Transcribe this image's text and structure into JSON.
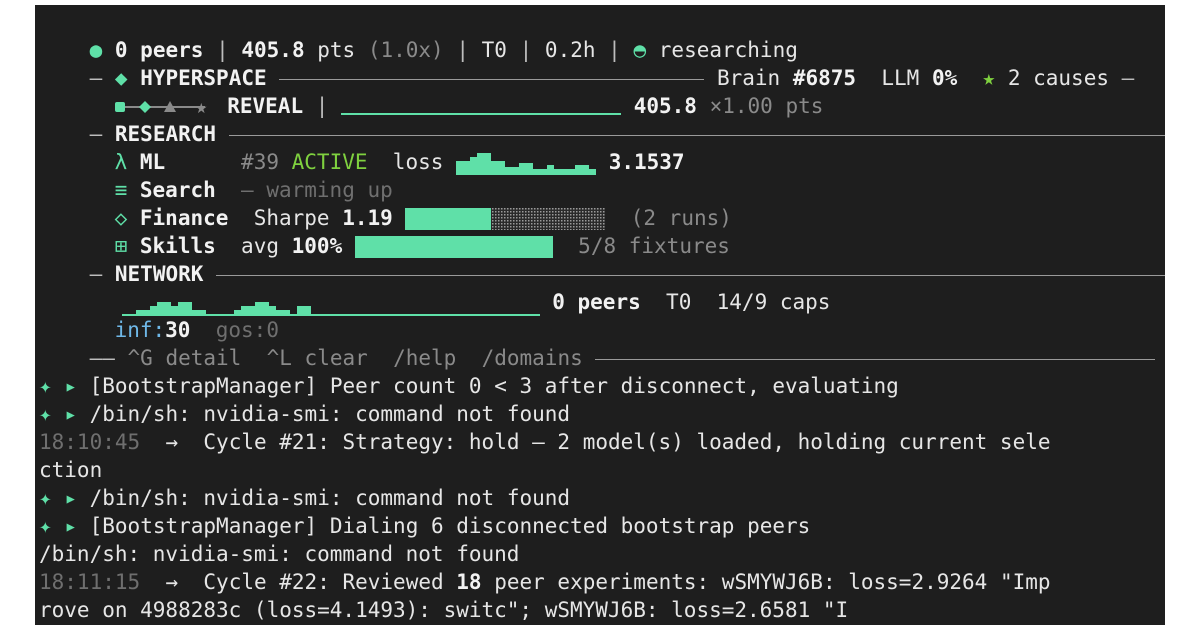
{
  "status": {
    "peers": "0 peers",
    "pts": "405.8",
    "pts_unit": " pts",
    "multiplier": "(1.0x)",
    "tier": "T0",
    "hours": "0.2h",
    "state": "researching"
  },
  "header": {
    "title": "HYPERSPACE",
    "brain_label": "Brain",
    "brain_id": "#6875",
    "llm_label": "LLM",
    "llm_value": "0%",
    "causes": "2 causes"
  },
  "reveal": {
    "label": "REVEAL",
    "pts": "405.8",
    "multiplier": "×1.00 pts"
  },
  "research": {
    "title": "RESEARCH",
    "ml": {
      "icon": "λ",
      "label": "ML",
      "run": "#39",
      "status": "ACTIVE",
      "metric_label": "loss",
      "metric_value": "3.1537"
    },
    "search": {
      "icon": "≡",
      "label": "Search",
      "status": "— warming up"
    },
    "finance": {
      "icon": "◇",
      "label": "Finance",
      "metric_label": "Sharpe",
      "metric_value": "1.19",
      "runs": "(2 runs)",
      "progress": 0.43
    },
    "skills": {
      "icon": "⊞",
      "label": "Skills",
      "metric_label": "avg",
      "metric_value": "100%",
      "fixtures": "5/8 fixtures",
      "progress": 1.0
    }
  },
  "network": {
    "title": "NETWORK",
    "peers": "0 peers",
    "tier": "T0",
    "caps": "14/9 caps",
    "inf_label": "inf:",
    "inf_value": "30",
    "gos": "gos:0"
  },
  "shortcuts": {
    "detail": "^G detail",
    "clear": "^L clear",
    "help": "/help",
    "domains": "/domains"
  },
  "log": {
    "l1": "[BootstrapManager] Peer count 0 < 3 after disconnect, evaluating",
    "l2": "/bin/sh: nvidia-smi: command not found",
    "l3_time": "18:10:45",
    "l3_text": "Cycle #21: Strategy: hold — 2 model(s) loaded, holding current sele",
    "l4": "ction",
    "l5": "/bin/sh: nvidia-smi: command not found",
    "l6": "[BootstrapManager] Dialing 6 disconnected bootstrap peers",
    "l7": "/bin/sh: nvidia-smi: command not found",
    "l8_time": "18:11:15",
    "l8_pre": "Cycle #22: Reviewed ",
    "l8_bold": "18",
    "l8_post": " peer experiments: wSMYWJ6B: loss=2.9264 \"Imp",
    "l9": "rove on 4988283c (loss=4.1493): switc\"; wSMYWJ6B: loss=2.6581 \"I"
  },
  "colors": {
    "background": "#1e1e1e",
    "accent": "#5fe0a8",
    "active": "#7fd13f",
    "dim": "#8a8a8a"
  }
}
